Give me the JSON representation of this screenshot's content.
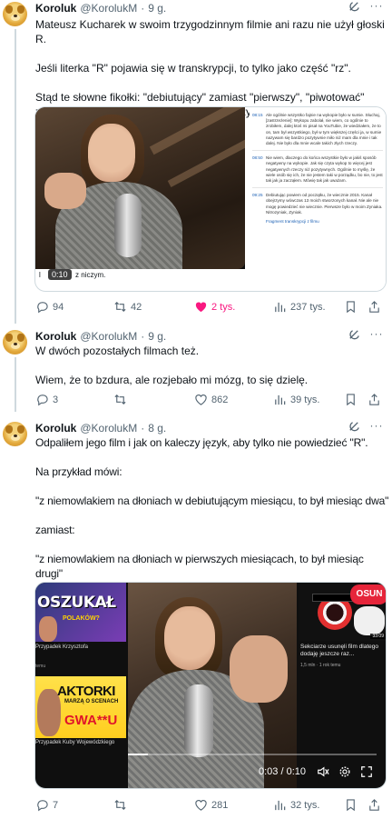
{
  "tweets": [
    {
      "author": "Koroluk",
      "handle": "@KorolukM",
      "sep": "·",
      "time": "9 g.",
      "more": "···",
      "text": "Mateusz Kucharek w swoim trzygodzinnym filmie ani razu nie użył głoski R.\n\nJeśli literka \"R\" pojawia się w transkrypcji, to tylko jako część \"rz\".\n\nStąd te słowne fikołki: \"debiutujący\" zamiast \"pierwszy\", \"piwotować\" zamiast \"zdradzić\", \"Zyniak\" zamiast \"Nitrozyniak\".",
      "media": {
        "video_time": "0:10",
        "caption_prefix": "l",
        "caption": "z niczym.",
        "transcript": [
          {
            "ts": "08:15",
            "text": "Ale ogólnie wszystko fajnie na wykopie było w sumie. Słuchaj, [zastrzeżenie]: Wykopu zabolał, nie wiem, co ogólnie to zrobiłem, dalej ktoś mi pisał na YouTubie, że wiedziałem, że to on, tam był wszystkiego, był w tym większej części ja, w sumie nazywam się bardzo pozytywnie miło niż mam dla mnie i tak dalej. Nie było dla mnie wcale takich złych rzeczy.",
            "hl": "YouTubie"
          },
          {
            "ts": "08:50",
            "text": "Nie wiem, dlaczego do końca wszystkie było w jakiś sposób negatywny na wykopie. Jak się czyta wykop to więcej jest negatywnych rzeczy niż pozytywnych. Ogólnie to myślę, że wiele osób się ich, że nie jestem taki w porządku, bo nie, to jest tak jak ja zacząłem. Mówię tak jak uważam.",
            "hl": ""
          },
          {
            "ts": "09:25",
            "text": "Debiutując powiem od początku, że wiecznie 2015. Kanał obejrzymy wówczas 13 moich stworzonych kanał. Nie ale nie mogę powiedzieć nie wiecznie. Pierwsze było w moim Zyniaka. Nitrozyniak, Zyniak.",
            "hl": "Zyniak"
          },
          {
            "ts": "",
            "text": "Fragment transkrypcji z filmu",
            "hl": ""
          }
        ]
      },
      "actions": {
        "replies": "94",
        "reposts": "42",
        "likes": "2 tys.",
        "views": "237 tys."
      }
    },
    {
      "author": "Koroluk",
      "handle": "@KorolukM",
      "sep": "·",
      "time": "9 g.",
      "more": "···",
      "text": "W dwóch pozostałych filmach też.\n\nWiem, że to bzdura, ale rozjebało mi mózg, to się dzielę.",
      "actions": {
        "replies": "3",
        "reposts": "",
        "likes": "862",
        "views": "39 tys."
      }
    },
    {
      "author": "Koroluk",
      "handle": "@KorolukM",
      "sep": "·",
      "time": "8 g.",
      "more": "···",
      "text": "Odpaliłem jego film i jak on kaleczy język, aby tylko nie powiedzieć \"R\".\n\nNa przykład mówi:\n\n\"z niemowlakiem na dłoniach w debiutującym miesiącu, to był miesiąc dwa\"\n\nzamiast:\n\n\"z niemowlakiem na dłoniach w pierwszych miesiącach, to był miesiąc drugi\"",
      "media": {
        "thumb_a_title": "OSZUKAŁ",
        "thumb_a_sub": "POLAKÓW?",
        "thumb_a_label": "Przypadek Krzysztofa",
        "thumb_a_meta": "temu",
        "thumb_b_title": "AKTORKI",
        "thumb_b_sub": "MARZĄ O SCENACH",
        "thumb_b_word": "GWA**U",
        "thumb_b_label": "Przypadek Kuby Wojewódzkiego",
        "thumb_c_badge": "OSUN TO!",
        "thumb_c_duration": "33:09",
        "thumb_c_title": "Sekciarze usunęli film dlatego dodaję jeszcze raz...",
        "thumb_c_meta": "1,5 mln · 1 rok temu",
        "time_display": "0:03 / 0:10",
        "progress": 0.08
      },
      "actions": {
        "replies": "7",
        "reposts": "",
        "likes": "281",
        "views": "32 tys."
      }
    }
  ],
  "colors": {
    "liked": "#f91880",
    "meta": "#536471",
    "link": "#1a5fb4"
  }
}
